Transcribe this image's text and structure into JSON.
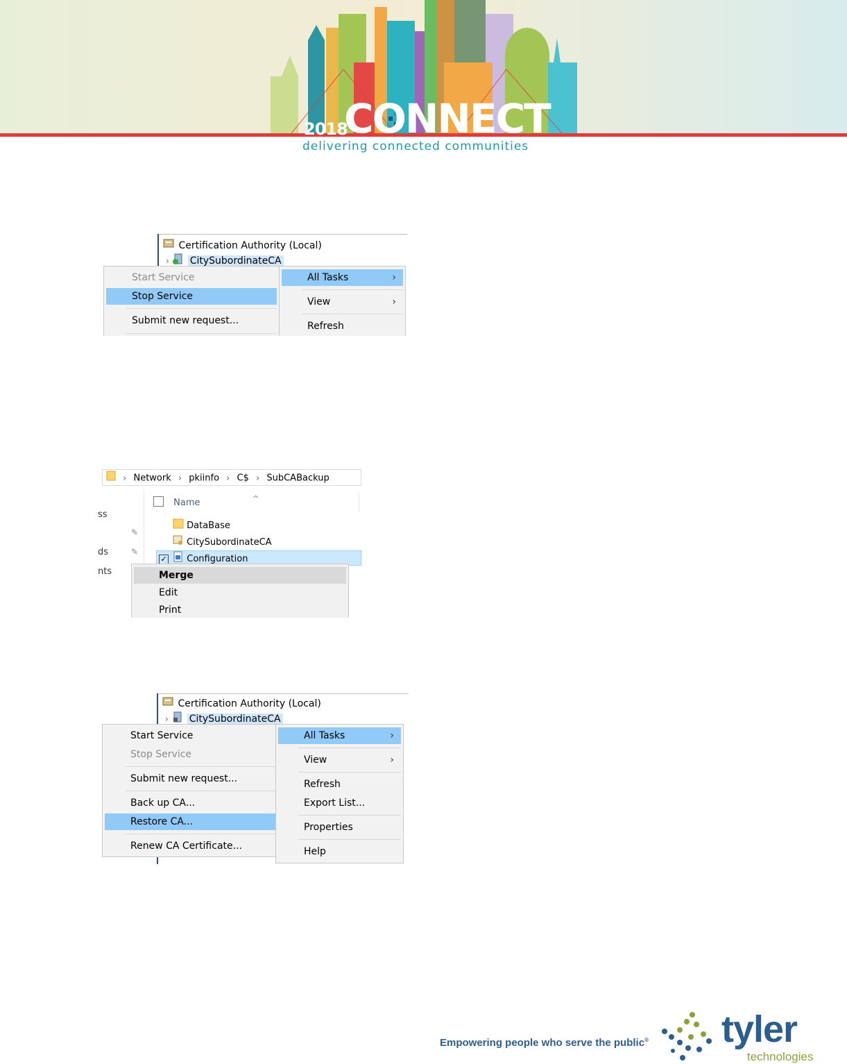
{
  "banner": {
    "year": "2018",
    "word": "CONNECT",
    "tagline": "delivering connected communities",
    "colors": {
      "red_line": "#e23b3b",
      "teal": "#1e9aa6",
      "orange": "#f3a33b",
      "green": "#9cc24a",
      "purple": "#9b59b6"
    }
  },
  "shot1": {
    "root_label": "Certification Authority (Local)",
    "ca_label": "CitySubordinateCA",
    "left_menu": [
      {
        "label": "Start Service",
        "disabled": true
      },
      {
        "label": "Stop Service",
        "highlight": true
      },
      {
        "label": "Submit new request..."
      }
    ],
    "right_menu": [
      {
        "label": "All Tasks",
        "highlight": true,
        "submenu": true
      },
      {
        "label": "View",
        "submenu": true
      },
      {
        "label": "Refresh"
      }
    ]
  },
  "shot2": {
    "breadcrumb": [
      "Network",
      "pkiinfo",
      "C$",
      "SubCABackup"
    ],
    "column_header": "Name",
    "left_fragments": [
      "ss",
      "ds",
      "nts"
    ],
    "files": [
      "DataBase",
      "CitySubordinateCA",
      "Configuration"
    ],
    "context_menu": [
      {
        "label": "Merge",
        "bold": true
      },
      {
        "label": "Edit"
      },
      {
        "label": "Print"
      }
    ]
  },
  "shot3": {
    "root_label": "Certification Authority (Local)",
    "ca_label": "CitySubordinateCA",
    "left_menu": [
      {
        "label": "Start Service"
      },
      {
        "label": "Stop Service",
        "disabled": true
      },
      {
        "label": "Submit new request..."
      },
      {
        "label": "Back up CA..."
      },
      {
        "label": "Restore CA...",
        "highlight": true
      },
      {
        "label": "Renew CA Certificate..."
      }
    ],
    "right_menu": [
      {
        "label": "All Tasks",
        "highlight": true,
        "submenu": true
      },
      {
        "label": "View",
        "submenu": true
      },
      {
        "label": "Refresh"
      },
      {
        "label": "Export List..."
      },
      {
        "label": "Properties"
      },
      {
        "label": "Help"
      }
    ]
  },
  "footer": {
    "tagline": "Empowering people who serve the public",
    "registered": "®",
    "logo_word": "tyler",
    "logo_sub": "technologies",
    "colors": {
      "blue": "#2d5c8e",
      "green": "#8aa23c"
    }
  }
}
